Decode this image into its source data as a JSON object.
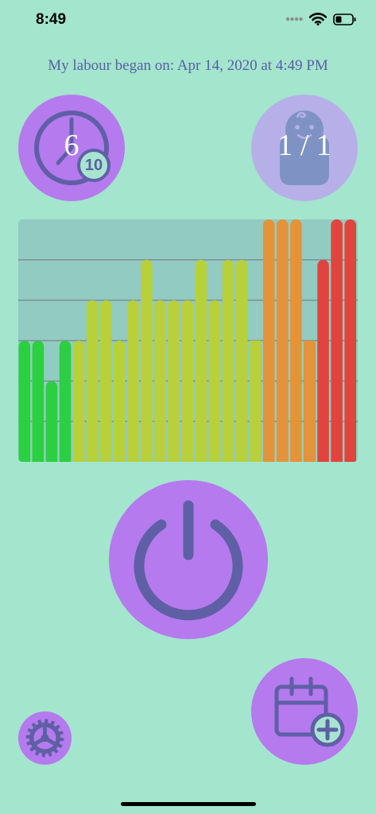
{
  "status_bar": {
    "time": "8:49",
    "icons": [
      "signal-dots-icon",
      "wifi-icon",
      "battery-icon"
    ]
  },
  "labour": {
    "text": "My labour began on: Apr 14, 2020 at 4:49 PM"
  },
  "timer": {
    "value": "6",
    "badge": "10",
    "icon": "clock-icon"
  },
  "baby": {
    "ratio": "1 / 1",
    "icon": "swaddled-baby-icon"
  },
  "chart_data": {
    "type": "bar",
    "values": [
      3,
      3,
      2,
      3,
      3,
      4,
      4,
      3,
      4,
      5,
      4,
      4,
      4,
      5,
      4,
      5,
      5,
      3,
      6,
      6,
      6,
      3,
      5,
      6,
      6
    ],
    "colors": [
      "#2ccf42",
      "#2ccf42",
      "#2ccf42",
      "#2ccf42",
      "#b8d03a",
      "#b8d03a",
      "#b8d03a",
      "#b8d03a",
      "#b8d03a",
      "#b8d03a",
      "#b8d03a",
      "#b8d03a",
      "#b8d03a",
      "#b8d03a",
      "#b8d03a",
      "#b8d03a",
      "#b8d03a",
      "#e3943a",
      "#e3943a",
      "#e3943a",
      "#e3943a",
      "#e0443e",
      "#e0443e",
      "#e0443e",
      "#e0443e"
    ],
    "overlay_colors": [
      "#2ccf42",
      "#2ccf42",
      "#2ccf42",
      "#2ccf42",
      "#b8d03a",
      "#b8d03a",
      "#b8d03a",
      "#b8d03a",
      "#b8d03a",
      "#b8d03a",
      "#b8d03a",
      "#b8d03a",
      "#b8d03a",
      "#b8d03a",
      "#b8d03a",
      "#b8d03a",
      "#b8d03a",
      "#b8d03a",
      "#e3943a",
      "#e3943a",
      "#e3943a",
      "#e3943a",
      "#e0443e",
      "#e0443e",
      "#e0443e"
    ],
    "ylim": [
      0,
      6
    ],
    "grid": true
  },
  "buttons": {
    "power": "power-icon",
    "calendar": "calendar-add-icon",
    "settings": "gear-icon"
  },
  "colors": {
    "background": "#a3e5cd",
    "accent": "#b57aee",
    "icon": "#5f5fa6",
    "text": "#5a5fa5"
  }
}
